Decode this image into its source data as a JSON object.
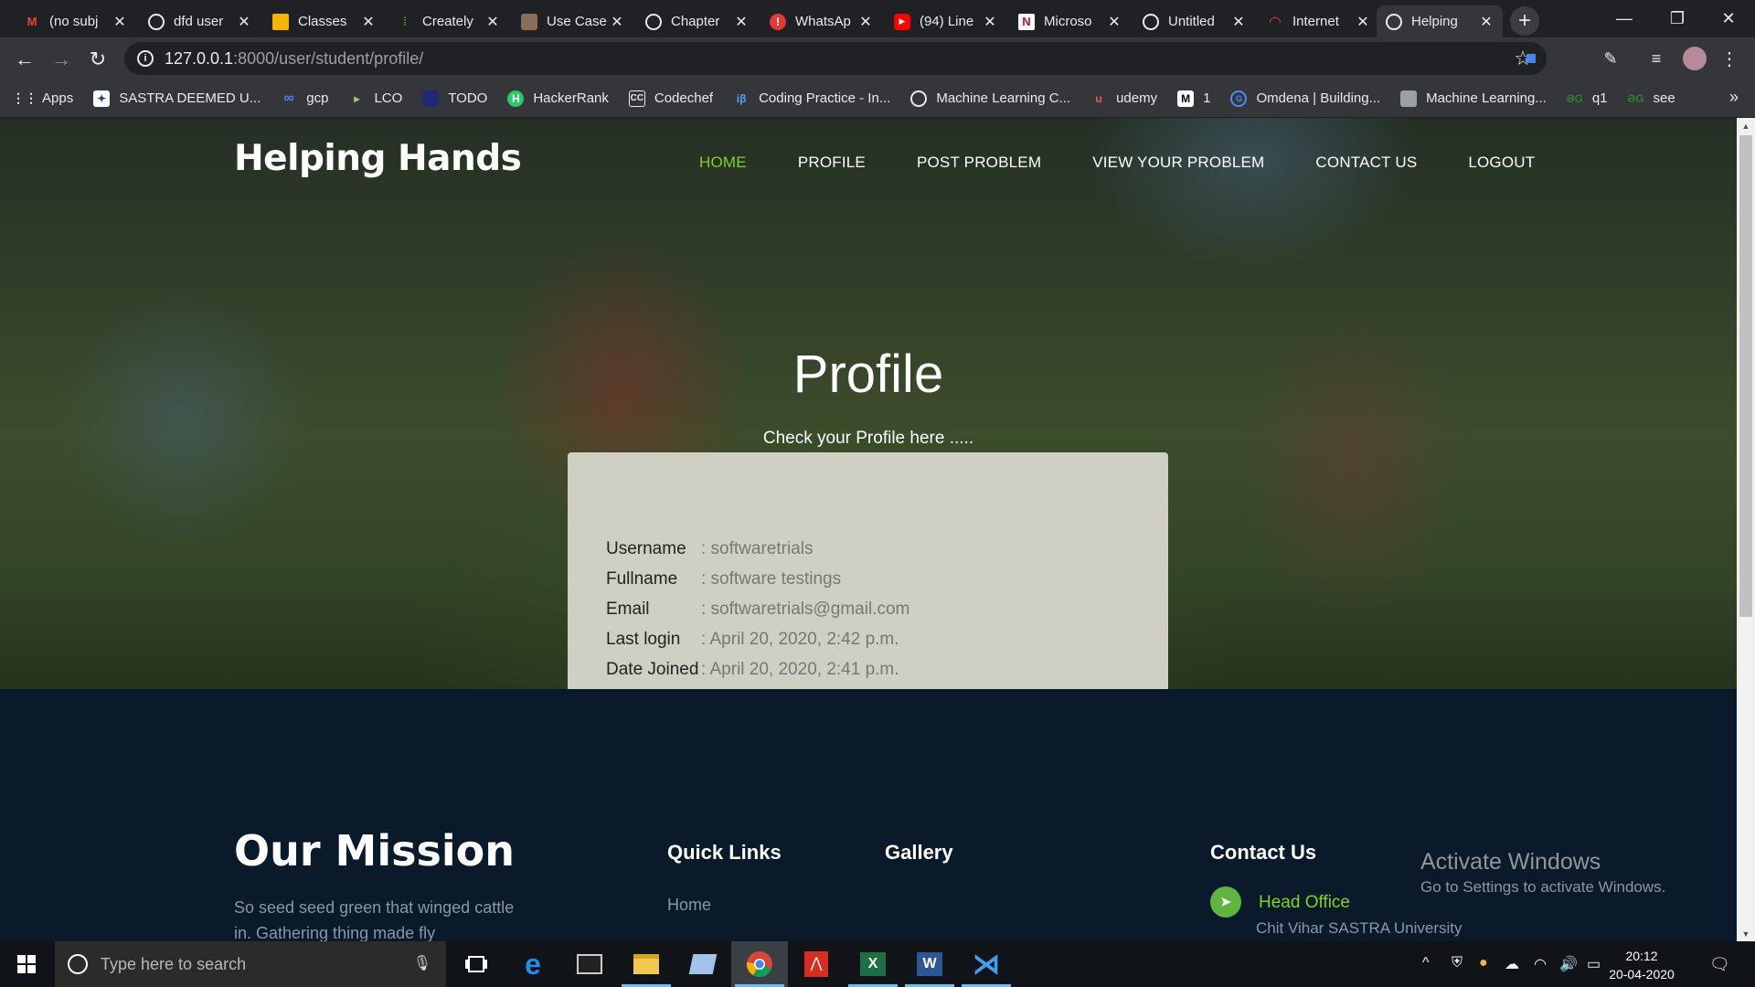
{
  "browser": {
    "tabs": [
      {
        "title": "(no subj",
        "icon": "gmail-icon"
      },
      {
        "title": "dfd user",
        "icon": "globe-icon"
      },
      {
        "title": "Classes",
        "icon": "classroom-icon"
      },
      {
        "title": "Creately",
        "icon": "creately-icon"
      },
      {
        "title": "Use Case",
        "icon": "usecase-icon"
      },
      {
        "title": "Chapter",
        "icon": "globe-icon"
      },
      {
        "title": "WhatsAp",
        "icon": "whatsapp-alert-icon"
      },
      {
        "title": "(94) Line",
        "icon": "youtube-icon"
      },
      {
        "title": "Microso",
        "icon": "microsoft-icon"
      },
      {
        "title": "Untitled",
        "icon": "globe-icon"
      },
      {
        "title": "Internet",
        "icon": "internet-icon"
      },
      {
        "title": "Helping",
        "icon": "globe-icon",
        "active": true
      }
    ],
    "url_host": "127.0.0.1",
    "url_rest": ":8000/user/student/profile/",
    "bookmarks": [
      {
        "label": "Apps",
        "icon": "apps-grid-icon"
      },
      {
        "label": "SASTRA DEEMED U...",
        "icon": "sastra-icon"
      },
      {
        "label": "gcp",
        "icon": "gcp-icon"
      },
      {
        "label": "LCO",
        "icon": "lco-icon"
      },
      {
        "label": "TODO",
        "icon": "todo-icon"
      },
      {
        "label": "HackerRank",
        "icon": "hackerrank-icon"
      },
      {
        "label": "Codechef",
        "icon": "codechef-icon"
      },
      {
        "label": "Coding Practice - In...",
        "icon": "interviewbit-icon"
      },
      {
        "label": "Machine Learning C...",
        "icon": "globe-icon"
      },
      {
        "label": "udemy",
        "icon": "udemy-icon"
      },
      {
        "label": "1",
        "icon": "medium-icon"
      },
      {
        "label": "Omdena | Building...",
        "icon": "omdena-icon"
      },
      {
        "label": "Machine Learning...",
        "icon": "ml-icon"
      },
      {
        "label": "q1",
        "icon": "link-icon"
      },
      {
        "label": "see",
        "icon": "link-icon"
      }
    ]
  },
  "site": {
    "logo": "Helping Hands",
    "nav": [
      "HOME",
      "PROFILE",
      "POST PROBLEM",
      "VIEW YOUR PROBLEM",
      "CONTACT US",
      "LOGOUT"
    ],
    "hero_title": "Profile",
    "hero_subtitle": "Check your Profile here .....",
    "profile": [
      {
        "label": "Username",
        "value": ": softwaretrials"
      },
      {
        "label": "Fullname",
        "value": ": software testings"
      },
      {
        "label": "Email",
        "value": ": softwaretrials@gmail.com"
      },
      {
        "label": "Last login",
        "value": ": April 20, 2020, 2:42 p.m."
      },
      {
        "label": "Date Joined",
        "value": ": April 20, 2020, 2:41 p.m."
      }
    ],
    "footer": {
      "mission_title": "Our Mission",
      "mission_text": "So seed seed green that winged cattle in. Gathering thing made fly",
      "quick_links_title": "Quick Links",
      "quick_link_home": "Home",
      "gallery_title": "Gallery",
      "contact_title": "Contact Us",
      "head_office": "Head Office",
      "address": "Chit Vihar SASTRA University"
    },
    "watermark": {
      "line1": "Activate Windows",
      "line2": "Go to Settings to activate Windows."
    }
  },
  "taskbar": {
    "search_placeholder": "Type here to search",
    "time": "20:12",
    "date": "20-04-2020"
  }
}
